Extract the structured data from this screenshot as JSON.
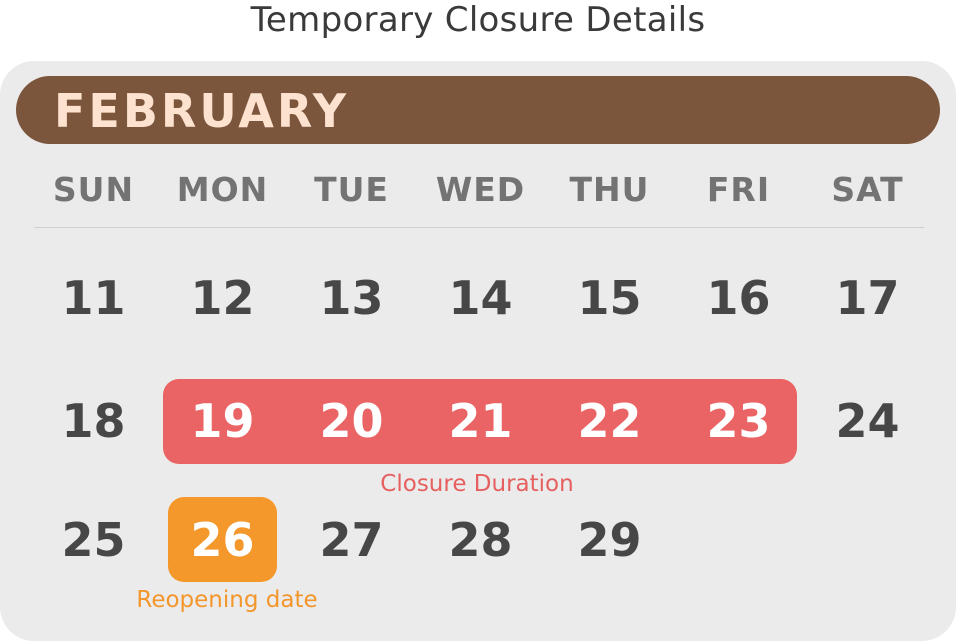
{
  "title": "Temporary Closure Details",
  "month": "FEBRUARY",
  "weekdays": [
    "SUN",
    "MON",
    "TUE",
    "WED",
    "THU",
    "FRI",
    "SAT"
  ],
  "weeks": [
    [
      "11",
      "12",
      "13",
      "14",
      "15",
      "16",
      "17"
    ],
    [
      "18",
      "19",
      "20",
      "21",
      "22",
      "23",
      "24"
    ],
    [
      "25",
      "26",
      "27",
      "28",
      "29"
    ]
  ],
  "closure": {
    "label": "Closure Duration",
    "dates": [
      "19",
      "20",
      "21",
      "22",
      "23"
    ],
    "color": "#ea6465"
  },
  "reopening": {
    "label": "Reopening date",
    "date": "26",
    "color": "#f5982c"
  },
  "colors": {
    "banner": "#7b563d",
    "banner_text": "#fde2cf",
    "card_background": "#ebebec",
    "weekday_text": "#737373",
    "day_text": "#474747"
  }
}
